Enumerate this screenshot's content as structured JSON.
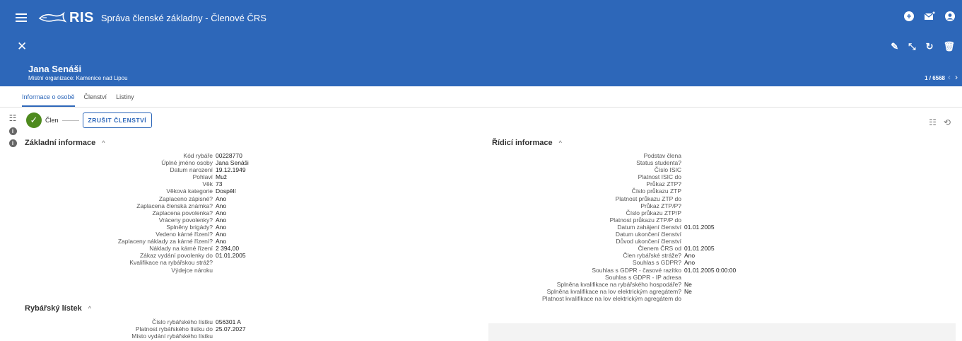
{
  "app": {
    "logo_text": "RIS",
    "title": "Správa členské základny - Členové ČRS"
  },
  "record": {
    "name": "Jana Senáši",
    "organization": "Místní organizace: Kamenice nad Lipou",
    "counter": "1 / 6568"
  },
  "tabs": [
    {
      "label": "Informace o osobě",
      "active": true
    },
    {
      "label": "Členství",
      "active": false
    },
    {
      "label": "Listiny",
      "active": false
    }
  ],
  "status": {
    "label": "Člen",
    "cancel_button": "ZRUŠIT ČLENSTVÍ"
  },
  "basic": {
    "title": "Základní informace",
    "fields": [
      {
        "label": "Kód rybáře",
        "value": "00228770"
      },
      {
        "label": "Úplné jméno osoby",
        "value": "Jana Senáši"
      },
      {
        "label": "Datum narození",
        "value": "19.12.1949"
      },
      {
        "label": "Pohlaví",
        "value": "Muž"
      },
      {
        "label": "Věk",
        "value": "73"
      },
      {
        "label": "Věková kategorie",
        "value": "Dospělí"
      },
      {
        "label": "Zaplaceno zápisné?",
        "value": "Ano"
      },
      {
        "label": "Zaplacena členská známka?",
        "value": "Ano"
      },
      {
        "label": "Zaplacena povolenka?",
        "value": "Ano"
      },
      {
        "label": "Vráceny povolenky?",
        "value": "Ano"
      },
      {
        "label": "Splněny brigády?",
        "value": "Ano"
      },
      {
        "label": "Vedeno kárné řízení?",
        "value": "Ano"
      },
      {
        "label": "Zaplaceny náklady za kárné řízení?",
        "value": "Ano"
      },
      {
        "label": "Náklady na kárné řízení",
        "value": "2 394,00"
      },
      {
        "label": "Zákaz vydání povolenky do",
        "value": "01.01.2005"
      },
      {
        "label": "Kvalifikace na rybářskou stráž?",
        "value": ""
      },
      {
        "label": "Výdejce nároku",
        "value": ""
      }
    ]
  },
  "license": {
    "title": "Rybářský lístek",
    "fields": [
      {
        "label": "Číslo rybářského lístku",
        "value": "056301 A"
      },
      {
        "label": "Platnost rybářského lístku do",
        "value": "25.07.2027"
      },
      {
        "label": "Místo vydání rybářského lístku",
        "value": ""
      }
    ]
  },
  "control": {
    "title": "Řídicí informace",
    "fields": [
      {
        "label": "Podstav člena",
        "value": ""
      },
      {
        "label": "Status studenta?",
        "value": ""
      },
      {
        "label": "Číslo ISIC",
        "value": ""
      },
      {
        "label": "Platnost ISIC do",
        "value": ""
      },
      {
        "label": "Průkaz ZTP?",
        "value": ""
      },
      {
        "label": "Číslo průkazu ZTP",
        "value": ""
      },
      {
        "label": "Platnost průkazu ZTP do",
        "value": ""
      },
      {
        "label": "Průkaz ZTP/P?",
        "value": ""
      },
      {
        "label": "Číslo průkazu ZTP/P",
        "value": ""
      },
      {
        "label": "Platnost průkazu ZTP/P do",
        "value": ""
      },
      {
        "label": "Datum zahájení členství",
        "value": "01.01.2005"
      },
      {
        "label": "Datum ukončení členství",
        "value": ""
      },
      {
        "label": "Důvod ukončení členství",
        "value": ""
      },
      {
        "label": "Členem ČRS od",
        "value": "01.01.2005"
      },
      {
        "label": "Člen rybářské stráže?",
        "value": "Ano"
      },
      {
        "label": "Souhlas s GDPR?",
        "value": "Ano"
      },
      {
        "label": "Souhlas s GDPR - časové razítko",
        "value": "01.01.2005 0:00:00"
      },
      {
        "label": "Souhlas s GDPR - IP adresa",
        "value": ""
      },
      {
        "label": "Splněna kvalifikace na rybářského hospodáře?",
        "value": "Ne"
      },
      {
        "label": "Splněna kvalifikace na lov elektrickým agregátem?",
        "value": "Ne"
      },
      {
        "label": "Platnost kvalifikace na lov elektrickým agregátem do",
        "value": ""
      }
    ]
  }
}
